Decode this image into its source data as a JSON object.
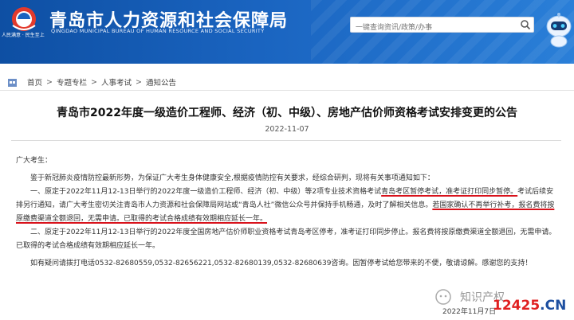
{
  "header": {
    "title": "青岛市人力资源和社会保障局",
    "subtitle": "QINGDAO MUNICIPAL BUREAU OF HUMAN RESOURCE AND SOCIAL SECURITY",
    "logo_caption": "人民满意 · 民生至上",
    "search_placeholder": "一键查询资讯/政策/办事"
  },
  "breadcrumb": {
    "items": [
      "首页",
      "专题专栏",
      "人事考试",
      "通知公告"
    ],
    "separator": ">"
  },
  "article": {
    "title": "青岛市2022年度一级造价工程师、经济（初、中级）、房地产估价师资格考试安排变更的公告",
    "date": "2022-11-07",
    "salutation": "广大考生：",
    "intro": "鉴于新冠肺炎疫情防控最新形势，为保证广大考生身体健康安全,根据疫情防控有关要求，经综合研判，现将有关事项通知如下：",
    "p1_a": "一、原定于2022年11月12-13日举行的2022年度一级造价工程师、经济（初、中级）等2项专业技术资格考试",
    "p1_u1": "青岛考区暂停考试，准考证打印同步暂停。",
    "p1_b": "考试后续安排另行通知，请广大考生密切关注青岛市人力资源和社会保障局网站或“青岛人社”微信公众号并保持手机畅通，及时了解相关信息。",
    "p1_u2": "若国家确认不再举行补考，报名费将按原缴费渠道全额退回，无需申请。已取得的考试合格成绩有效期相应延长一年。",
    "p2": "二、原定于2022年11月12-13日举行的2022年度全国房地产估价师职业资格考试青岛考区停考，准考证打印同步停止。报名费将按原缴费渠道全额退回，无需申请。已取得的考试合格成绩有效期相应延长一年。",
    "contact": "如有疑问请拨打电话0532-82680559,0532-82656221,0532-82680139,0532-82680639咨询。因暂停考试给您带来的不便，敬请谅解。感谢您的支持！",
    "sign_date": "2022年11月7日"
  },
  "watermark": {
    "text": "知识产权",
    "site_a": "12425",
    "site_b": ".CN"
  },
  "colors": {
    "header_blue": "#1a64c0",
    "underline_red": "#d8121b",
    "watermark_red": "#e02020"
  },
  "icons": {
    "search": "search-icon",
    "home": "home-icon",
    "robot": "robot-assistant-icon",
    "logo": "bureau-logo-icon"
  }
}
